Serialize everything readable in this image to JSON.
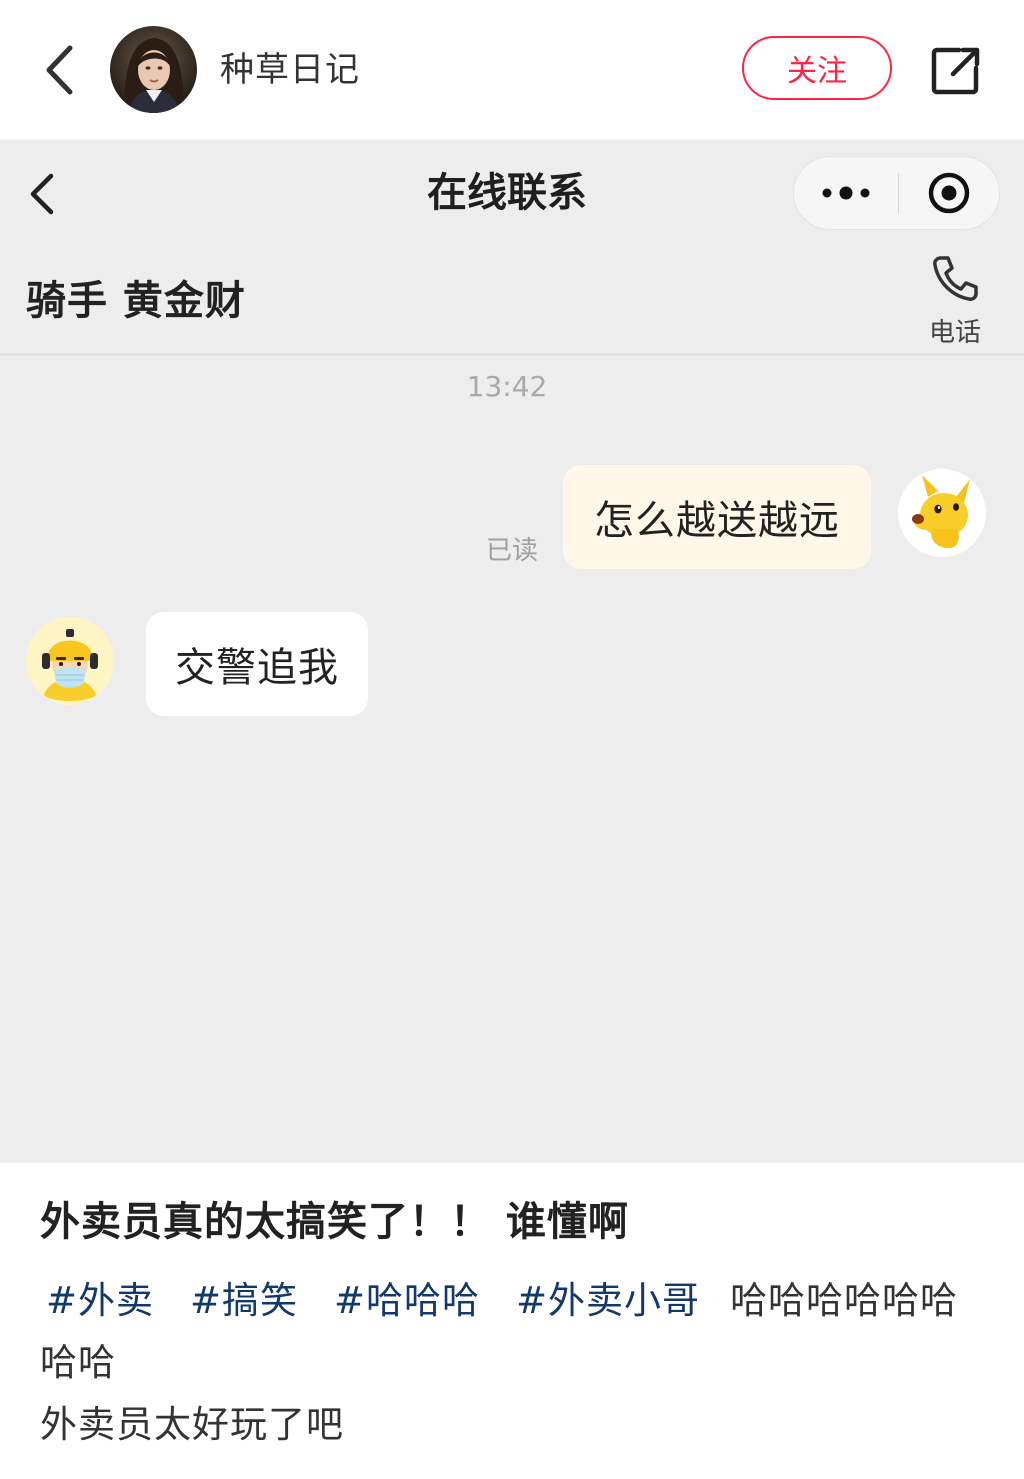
{
  "post_header": {
    "author_name": "种草日记",
    "follow_label": "关注"
  },
  "chat": {
    "title": "在线联系",
    "rider_name": "骑手 黄金财",
    "phone_label": "电话",
    "timestamp": "13:42",
    "messages": [
      {
        "sender": "me",
        "text": "怎么越送越远",
        "status": "已读"
      },
      {
        "sender": "rider",
        "text": "交警追我"
      }
    ]
  },
  "post": {
    "title": "外卖员真的太搞笑了！！ 谁懂啊",
    "tags": [
      "#外卖",
      "#搞笑",
      "#哈哈哈",
      "#外卖小哥"
    ],
    "body_inline": "哈哈哈哈哈哈哈哈",
    "body_line2": "外卖员太好玩了吧"
  },
  "colors": {
    "accent_red": "#ff2442",
    "tag_blue": "#13386c",
    "chat_bg": "#ededed",
    "sent_bubble": "#fff8e8"
  }
}
